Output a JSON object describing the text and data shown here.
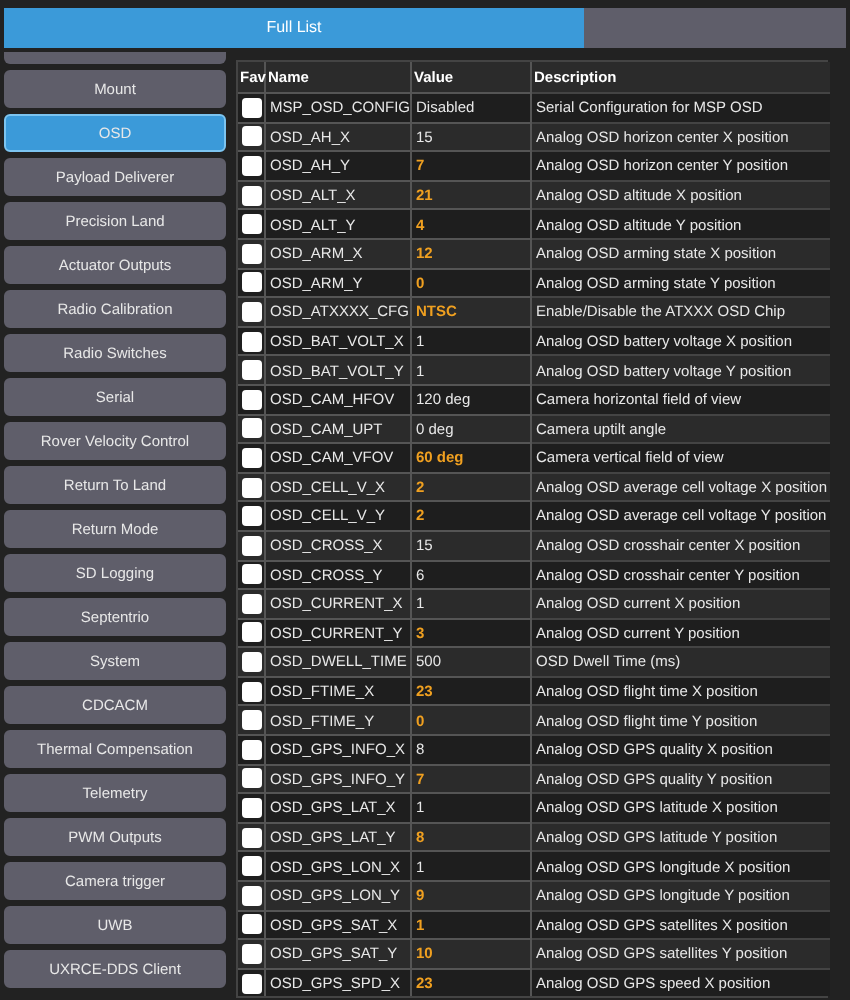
{
  "tabs": [
    {
      "label": "Full List",
      "selected": true
    }
  ],
  "sidebar": {
    "items": [
      {
        "label": "Mount",
        "selected": false
      },
      {
        "label": "OSD",
        "selected": true
      },
      {
        "label": "Payload Deliverer",
        "selected": false
      },
      {
        "label": "Precision Land",
        "selected": false
      },
      {
        "label": "Actuator Outputs",
        "selected": false
      },
      {
        "label": "Radio Calibration",
        "selected": false
      },
      {
        "label": "Radio Switches",
        "selected": false
      },
      {
        "label": "Serial",
        "selected": false
      },
      {
        "label": "Rover Velocity Control",
        "selected": false
      },
      {
        "label": "Return To Land",
        "selected": false
      },
      {
        "label": "Return Mode",
        "selected": false
      },
      {
        "label": "SD Logging",
        "selected": false
      },
      {
        "label": "Septentrio",
        "selected": false
      },
      {
        "label": "System",
        "selected": false
      },
      {
        "label": "CDCACM",
        "selected": false
      },
      {
        "label": "Thermal Compensation",
        "selected": false
      },
      {
        "label": "Telemetry",
        "selected": false
      },
      {
        "label": "PWM Outputs",
        "selected": false
      },
      {
        "label": "Camera trigger",
        "selected": false
      },
      {
        "label": "UWB",
        "selected": false
      },
      {
        "label": "UXRCE-DDS Client",
        "selected": false
      }
    ]
  },
  "table": {
    "columns": [
      "Fav",
      "Name",
      "Value",
      "Description"
    ],
    "rows": [
      {
        "fav": false,
        "name": "MSP_OSD_CONFIG",
        "value": "Disabled",
        "modified": false,
        "description": "Serial Configuration for MSP OSD"
      },
      {
        "fav": false,
        "name": "OSD_AH_X",
        "value": "15",
        "modified": false,
        "description": "Analog OSD horizon center X position"
      },
      {
        "fav": false,
        "name": "OSD_AH_Y",
        "value": "7",
        "modified": true,
        "description": "Analog OSD horizon center Y position"
      },
      {
        "fav": false,
        "name": "OSD_ALT_X",
        "value": "21",
        "modified": true,
        "description": "Analog OSD altitude X position"
      },
      {
        "fav": false,
        "name": "OSD_ALT_Y",
        "value": "4",
        "modified": true,
        "description": "Analog OSD altitude Y position"
      },
      {
        "fav": false,
        "name": "OSD_ARM_X",
        "value": "12",
        "modified": true,
        "description": "Analog OSD arming state X position"
      },
      {
        "fav": false,
        "name": "OSD_ARM_Y",
        "value": "0",
        "modified": true,
        "description": "Analog OSD arming state Y position"
      },
      {
        "fav": false,
        "name": "OSD_ATXXXX_CFG",
        "value": "NTSC",
        "modified": true,
        "description": "Enable/Disable the ATXXX OSD Chip"
      },
      {
        "fav": false,
        "name": "OSD_BAT_VOLT_X",
        "value": "1",
        "modified": false,
        "description": "Analog OSD battery voltage X position"
      },
      {
        "fav": false,
        "name": "OSD_BAT_VOLT_Y",
        "value": "1",
        "modified": false,
        "description": "Analog OSD battery voltage Y position"
      },
      {
        "fav": false,
        "name": "OSD_CAM_HFOV",
        "value": "120 deg",
        "modified": false,
        "description": "Camera horizontal field of view"
      },
      {
        "fav": false,
        "name": "OSD_CAM_UPT",
        "value": "0 deg",
        "modified": false,
        "description": "Camera uptilt angle"
      },
      {
        "fav": false,
        "name": "OSD_CAM_VFOV",
        "value": "60 deg",
        "modified": true,
        "description": "Camera vertical field of view"
      },
      {
        "fav": false,
        "name": "OSD_CELL_V_X",
        "value": "2",
        "modified": true,
        "description": "Analog OSD average cell voltage X position"
      },
      {
        "fav": false,
        "name": "OSD_CELL_V_Y",
        "value": "2",
        "modified": true,
        "description": "Analog OSD average cell voltage Y position"
      },
      {
        "fav": false,
        "name": "OSD_CROSS_X",
        "value": "15",
        "modified": false,
        "description": "Analog OSD crosshair center X position"
      },
      {
        "fav": false,
        "name": "OSD_CROSS_Y",
        "value": "6",
        "modified": false,
        "description": "Analog OSD crosshair center Y position"
      },
      {
        "fav": false,
        "name": "OSD_CURRENT_X",
        "value": "1",
        "modified": false,
        "description": "Analog OSD current X position"
      },
      {
        "fav": false,
        "name": "OSD_CURRENT_Y",
        "value": "3",
        "modified": true,
        "description": "Analog OSD current Y position"
      },
      {
        "fav": false,
        "name": "OSD_DWELL_TIME",
        "value": "500",
        "modified": false,
        "description": "OSD Dwell Time (ms)"
      },
      {
        "fav": false,
        "name": "OSD_FTIME_X",
        "value": "23",
        "modified": true,
        "description": "Analog OSD flight time X position"
      },
      {
        "fav": false,
        "name": "OSD_FTIME_Y",
        "value": "0",
        "modified": true,
        "description": "Analog OSD flight time Y position"
      },
      {
        "fav": false,
        "name": "OSD_GPS_INFO_X",
        "value": "8",
        "modified": false,
        "description": "Analog OSD GPS quality X position"
      },
      {
        "fav": false,
        "name": "OSD_GPS_INFO_Y",
        "value": "7",
        "modified": true,
        "description": "Analog OSD GPS quality Y position"
      },
      {
        "fav": false,
        "name": "OSD_GPS_LAT_X",
        "value": "1",
        "modified": false,
        "description": "Analog OSD GPS latitude X position"
      },
      {
        "fav": false,
        "name": "OSD_GPS_LAT_Y",
        "value": "8",
        "modified": true,
        "description": "Analog OSD GPS latitude Y position"
      },
      {
        "fav": false,
        "name": "OSD_GPS_LON_X",
        "value": "1",
        "modified": false,
        "description": "Analog OSD GPS longitude X position"
      },
      {
        "fav": false,
        "name": "OSD_GPS_LON_Y",
        "value": "9",
        "modified": true,
        "description": "Analog OSD GPS longitude Y position"
      },
      {
        "fav": false,
        "name": "OSD_GPS_SAT_X",
        "value": "1",
        "modified": true,
        "description": "Analog OSD GPS satellites X position"
      },
      {
        "fav": false,
        "name": "OSD_GPS_SAT_Y",
        "value": "10",
        "modified": true,
        "description": "Analog OSD GPS satellites Y position"
      },
      {
        "fav": false,
        "name": "OSD_GPS_SPD_X",
        "value": "23",
        "modified": true,
        "description": "Analog OSD GPS speed X position"
      }
    ]
  }
}
